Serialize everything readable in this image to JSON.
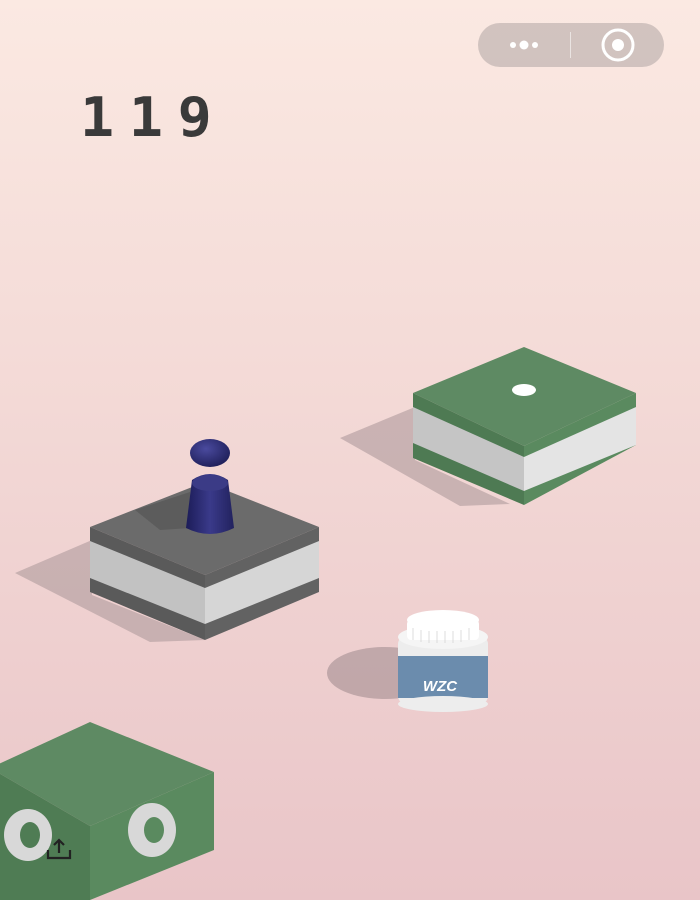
{
  "score": "119",
  "jar": {
    "label": "WZC"
  },
  "colors": {
    "green_top": "#5e8a63",
    "green_side_left": "#4e7a53",
    "green_side_right": "#5a8a5f",
    "white_band_left": "#c5c5c5",
    "white_band_right": "#e4e4e4",
    "gray_top": "#6b6b6b",
    "gray_side_left": "#5a5a5a",
    "gray_side_right": "#626262",
    "player": "#2f2f6e",
    "jar_label": "#6b8cad"
  },
  "icons": {
    "capsule_more": "more-dots-icon",
    "capsule_close": "target-circle-icon",
    "share": "share-upload-icon"
  }
}
